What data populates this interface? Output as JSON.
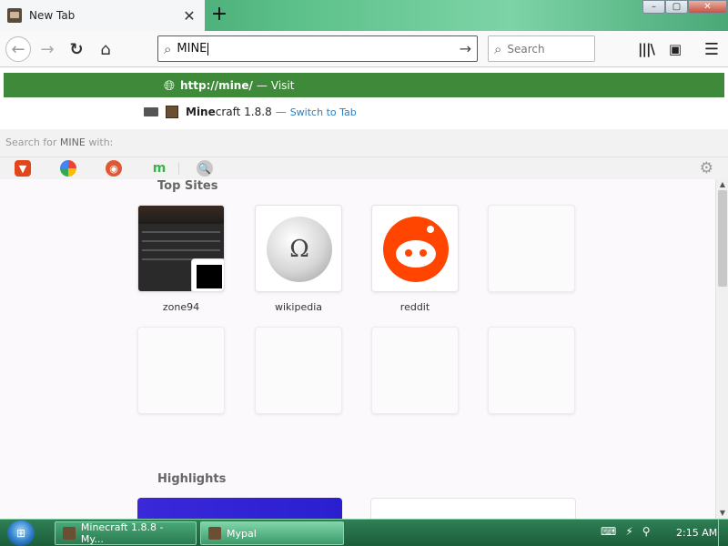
{
  "window": {
    "tab_title": "New Tab",
    "new_tab_symbol": "+",
    "close_tab_symbol": "✕",
    "controls": {
      "minimize": "–",
      "maximize": "▢",
      "close": "✕"
    }
  },
  "toolbar": {
    "back": "←",
    "forward": "→",
    "reload": "↻",
    "home": "⌂",
    "url_value": "MINE",
    "go_arrow": "→",
    "search_placeholder": "Search",
    "library": "|||\\",
    "sidebar": "▣",
    "menu": "☰"
  },
  "url_popup": {
    "visit_url": "http://mine/",
    "visit_sep": "—",
    "visit_action": "Visit",
    "switch_match": "Mine",
    "switch_rest": "craft 1.8.8",
    "switch_sep": "—",
    "switch_action": "Switch to Tab",
    "search_for_prefix": "Search for",
    "search_for_term": "MINE",
    "search_for_suffix": "with:",
    "engines": [
      "brave",
      "google",
      "duckduckgo",
      "m",
      "generic"
    ],
    "engine_m_label": "m",
    "engine_generic_label": "🔍",
    "gear": "⚙"
  },
  "page": {
    "top_sites_title": "Top Sites",
    "highlights_title": "Highlights",
    "top_sites": [
      {
        "label": "zone94"
      },
      {
        "label": "wikipedia",
        "glyph": "Ω"
      },
      {
        "label": "reddit"
      }
    ]
  },
  "taskbar": {
    "items": [
      {
        "label": "Minecraft 1.8.8 - My..."
      },
      {
        "label": "Mypal"
      }
    ],
    "clock": "2:15 AM"
  },
  "colors": {
    "visit_row": "#3f8a3a",
    "link": "#2a7ec4",
    "taskbar": "#1b5e3a"
  }
}
